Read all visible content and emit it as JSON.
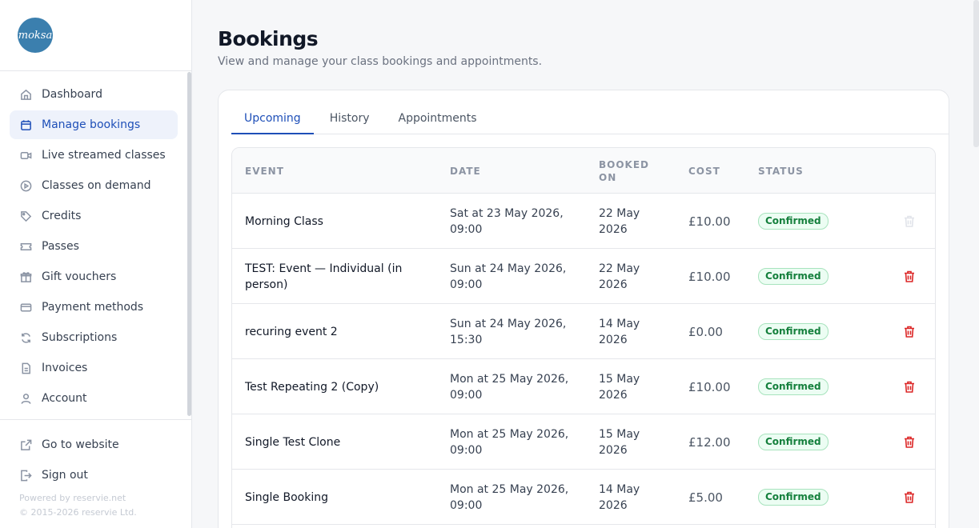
{
  "brand": {
    "logo_text": "moksa",
    "accent": "#1e4fb8",
    "logo_color": "#3b7fae"
  },
  "sidebar": {
    "items": [
      {
        "label": "Dashboard",
        "icon": "home-icon",
        "active": false
      },
      {
        "label": "Manage bookings",
        "icon": "calendar-icon",
        "active": true
      },
      {
        "label": "Live streamed classes",
        "icon": "video-icon",
        "active": false
      },
      {
        "label": "Classes on demand",
        "icon": "play-circle-icon",
        "active": false
      },
      {
        "label": "Credits",
        "icon": "tag-icon",
        "active": false
      },
      {
        "label": "Passes",
        "icon": "ticket-icon",
        "active": false
      },
      {
        "label": "Gift vouchers",
        "icon": "gift-icon",
        "active": false
      },
      {
        "label": "Payment methods",
        "icon": "credit-card-icon",
        "active": false
      },
      {
        "label": "Subscriptions",
        "icon": "refresh-icon",
        "active": false
      },
      {
        "label": "Invoices",
        "icon": "document-icon",
        "active": false
      },
      {
        "label": "Account",
        "icon": "user-icon",
        "active": false
      }
    ],
    "bottom": [
      {
        "label": "Go to website",
        "icon": "external-link-icon"
      },
      {
        "label": "Sign out",
        "icon": "sign-out-icon"
      }
    ],
    "powered_by": "Powered by reservie.net",
    "copyright": "© 2015-2026 reservie Ltd."
  },
  "page": {
    "title": "Bookings",
    "subtitle": "View and manage your class bookings and appointments."
  },
  "tabs": [
    {
      "label": "Upcoming",
      "active": true
    },
    {
      "label": "History",
      "active": false
    },
    {
      "label": "Appointments",
      "active": false
    }
  ],
  "table": {
    "headers": {
      "event": "EVENT",
      "date": "DATE",
      "booked_on_1": "BOOKED",
      "booked_on_2": "ON",
      "cost": "COST",
      "status": "STATUS"
    },
    "rows": [
      {
        "event": "Morning Class",
        "date_1": "Sat at 23 May 2026,",
        "date_2": "09:00",
        "booked_1": "22 May",
        "booked_2": "2026",
        "cost": "£10.00",
        "status": "Confirmed",
        "can_delete": false
      },
      {
        "event": "TEST: Event — Individual (in person)",
        "date_1": "Sun at 24 May 2026,",
        "date_2": "09:00",
        "booked_1": "22 May",
        "booked_2": "2026",
        "cost": "£10.00",
        "status": "Confirmed",
        "can_delete": true
      },
      {
        "event": "recuring event 2",
        "date_1": "Sun at 24 May 2026,",
        "date_2": "15:30",
        "booked_1": "14 May",
        "booked_2": "2026",
        "cost": "£0.00",
        "status": "Confirmed",
        "can_delete": true
      },
      {
        "event": "Test Repeating 2 (Copy)",
        "date_1": "Mon at 25 May 2026,",
        "date_2": "09:00",
        "booked_1": "15 May",
        "booked_2": "2026",
        "cost": "£10.00",
        "status": "Confirmed",
        "can_delete": true
      },
      {
        "event": "Single Test Clone",
        "date_1": "Mon at 25 May 2026,",
        "date_2": "09:00",
        "booked_1": "15 May",
        "booked_2": "2026",
        "cost": "£12.00",
        "status": "Confirmed",
        "can_delete": true
      },
      {
        "event": "Single Booking",
        "date_1": "Mon at 25 May 2026,",
        "date_2": "09:00",
        "booked_1": "14 May",
        "booked_2": "2026",
        "cost": "£5.00",
        "status": "Confirmed",
        "can_delete": true
      }
    ]
  }
}
